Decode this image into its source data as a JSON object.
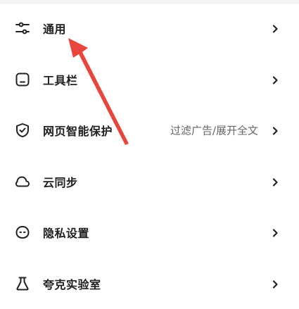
{
  "menu": {
    "items": [
      {
        "label": "通用",
        "desc": "",
        "icon": "sliders-icon"
      },
      {
        "label": "工具栏",
        "desc": "",
        "icon": "toolbar-icon"
      },
      {
        "label": "网页智能保护",
        "desc": "过滤广告/展开全文",
        "icon": "shield-check-icon"
      },
      {
        "label": "云同步",
        "desc": "",
        "icon": "cloud-icon"
      },
      {
        "label": "隐私设置",
        "desc": "",
        "icon": "privacy-face-icon"
      },
      {
        "label": "夸克实验室",
        "desc": "",
        "icon": "flask-icon"
      }
    ]
  },
  "colors": {
    "annotation_arrow": "#e8453c",
    "text": "#202020",
    "desc_text": "#666666"
  }
}
